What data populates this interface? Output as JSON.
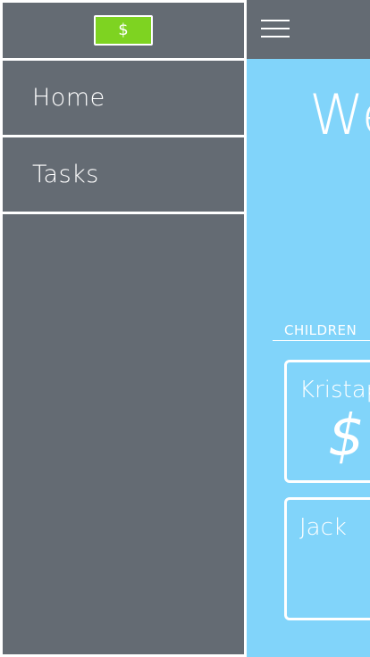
{
  "drawer": {
    "logo_symbol": "$",
    "items": [
      {
        "label": "Home"
      },
      {
        "label": "Tasks"
      }
    ]
  },
  "main": {
    "welcome_partial": "We",
    "section_label": "CHILDREN",
    "children": [
      {
        "name_partial": "Kristap",
        "balance_partial": "$"
      },
      {
        "name_partial": "Jack",
        "balance_partial": ""
      }
    ]
  },
  "colors": {
    "drawer_bg": "#646b73",
    "main_bg": "#81d4fa",
    "logo_bg": "#7ed321",
    "text": "#ffffff"
  },
  "icons": {
    "menu": "hamburger-menu-icon",
    "logo": "dollar-bill-icon"
  }
}
